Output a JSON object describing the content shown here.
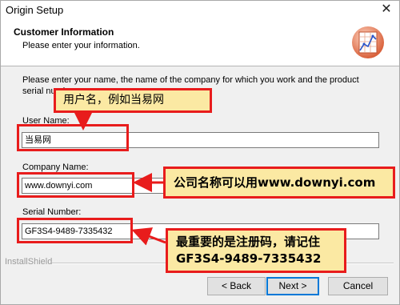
{
  "window": {
    "title": "Origin Setup",
    "close_glyph": "✕"
  },
  "header": {
    "title": "Customer Information",
    "subtitle": "Please enter your information.",
    "logo_icon": "origin-chart-logo-icon"
  },
  "form": {
    "instructions": "Please enter your name, the name of the company for which you work and the product serial number.",
    "user_name": {
      "label": "User Name:",
      "value": "当易网"
    },
    "company_name": {
      "label": "Company Name:",
      "value": "www.downyi.com"
    },
    "serial_number": {
      "label": "Serial Number:",
      "value": "GF3S4-9489-7335432"
    }
  },
  "annotations": {
    "callout_user": "用户名，例如当易网",
    "callout_company": "公司名称可以用www.downyi.com",
    "callout_serial_line1": "最重要的是注册码，请记住",
    "callout_serial_line2": "GF3S4-9489-7335432",
    "highlight_color": "#e81c1c",
    "callout_bg": "#fbe9a3"
  },
  "footer": {
    "brand": "InstallShield",
    "back_label": "< Back",
    "next_label": "Next >",
    "cancel_label": "Cancel"
  }
}
